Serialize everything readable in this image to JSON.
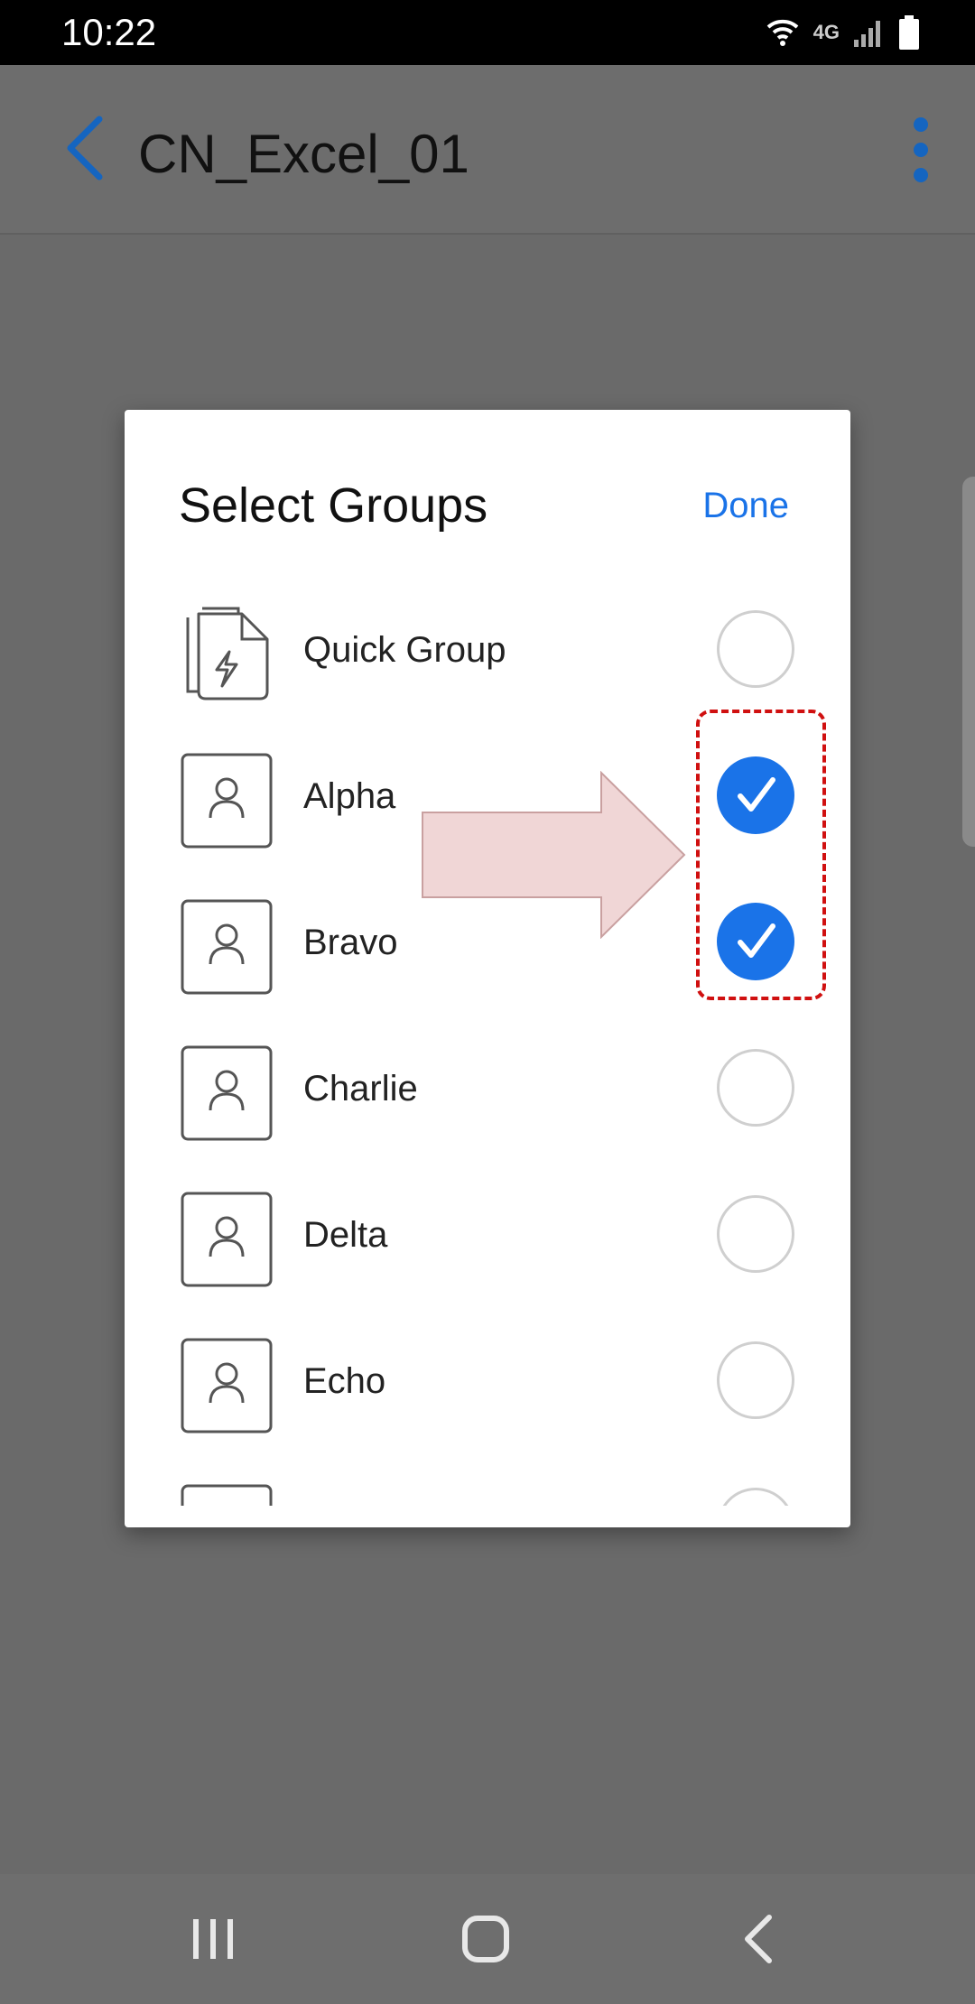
{
  "status_bar": {
    "time": "10:22",
    "icons": [
      "wifi-icon",
      "4g-lte-icon",
      "signal-icon",
      "battery-icon"
    ],
    "network_label": "4G"
  },
  "app_bar": {
    "title": "CN_Excel_01",
    "back_icon": "chevron-left-icon",
    "menu_icon": "more-vertical-icon",
    "accent_color": "#1565c0"
  },
  "dialog": {
    "title": "Select Groups",
    "done_label": "Done",
    "accent_color": "#1a73e8",
    "items": [
      {
        "label": "Quick Group",
        "icon": "quick-group-icon",
        "selected": false
      },
      {
        "label": "Alpha",
        "icon": "person-group-icon",
        "selected": true
      },
      {
        "label": "Bravo",
        "icon": "person-group-icon",
        "selected": true
      },
      {
        "label": "Charlie",
        "icon": "person-group-icon",
        "selected": false
      },
      {
        "label": "Delta",
        "icon": "person-group-icon",
        "selected": false
      },
      {
        "label": "Echo",
        "icon": "person-group-icon",
        "selected": false
      },
      {
        "label": "",
        "icon": "person-group-icon",
        "selected": false
      }
    ]
  },
  "annotation": {
    "highlight_color": "#d01010",
    "arrow_fill": "#f0d6d6"
  },
  "nav_bar": {
    "icons": [
      "recent-apps-icon",
      "home-icon",
      "back-icon"
    ]
  }
}
